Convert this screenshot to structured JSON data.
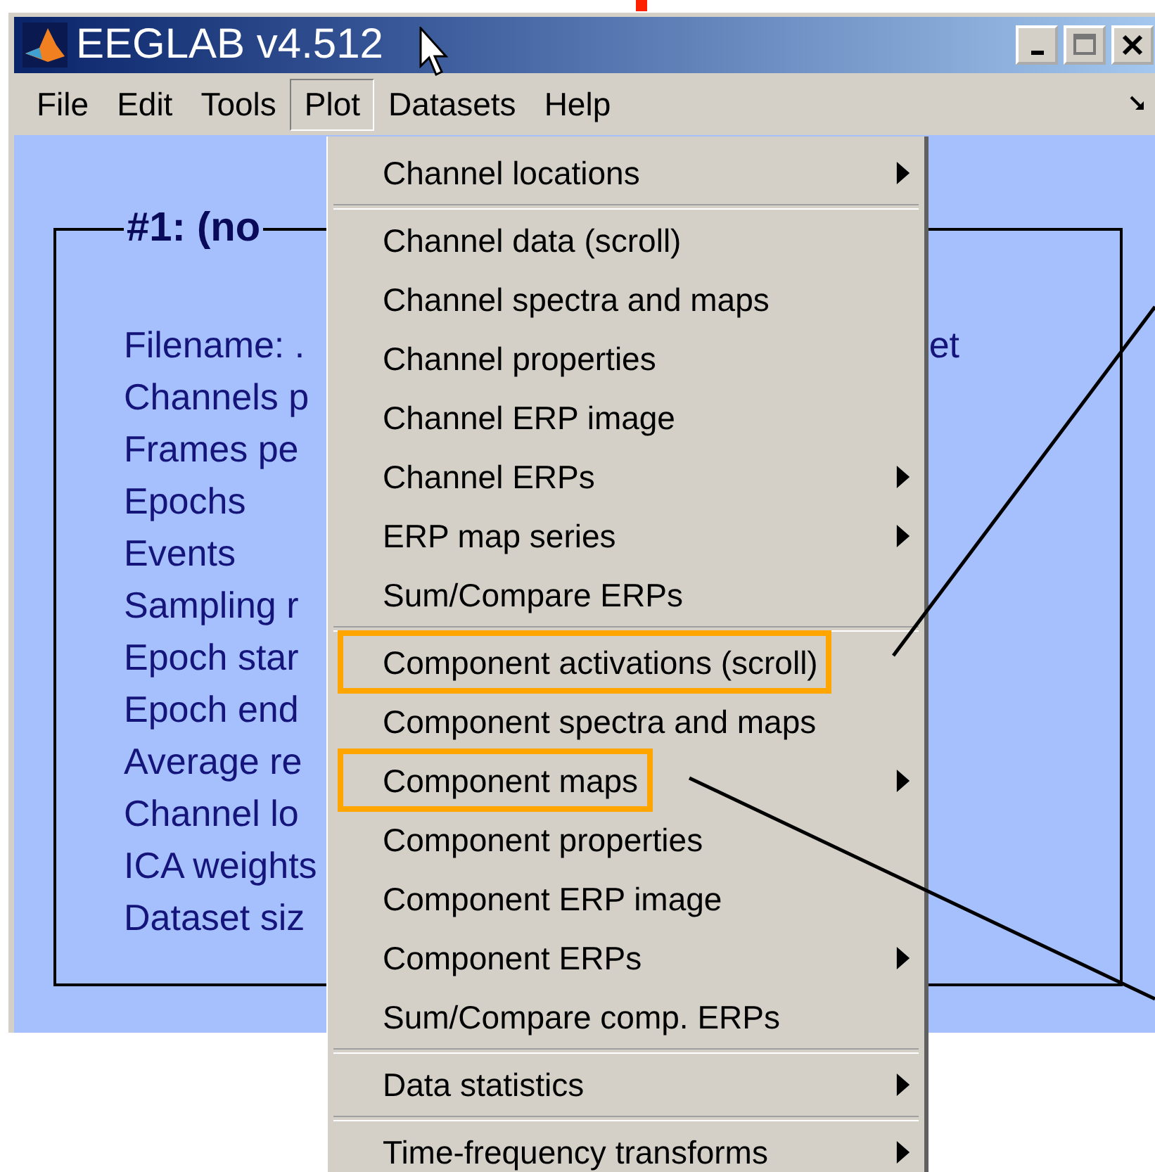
{
  "window": {
    "title": "EEGLAB v4.512"
  },
  "menubar": [
    {
      "label": "File",
      "selected": false
    },
    {
      "label": "Edit",
      "selected": false
    },
    {
      "label": "Tools",
      "selected": false
    },
    {
      "label": "Plot",
      "selected": true
    },
    {
      "label": "Datasets",
      "selected": false
    },
    {
      "label": "Help",
      "selected": false
    }
  ],
  "dataset_panel": {
    "title": "#1: (no",
    "lines": [
      {
        "label": "Filename: .",
        "value": "et"
      },
      {
        "label": "Channels p"
      },
      {
        "label": "Frames pe"
      },
      {
        "label": "Epochs"
      },
      {
        "label": "Events"
      },
      {
        "label": "Sampling r"
      },
      {
        "label": "Epoch star"
      },
      {
        "label": "Epoch end"
      },
      {
        "label": "Average re"
      },
      {
        "label": "Channel lo"
      },
      {
        "label": "ICA weights"
      },
      {
        "label": "Dataset siz"
      }
    ]
  },
  "plot_menu": {
    "sections": [
      {
        "items": [
          {
            "label": "Channel locations",
            "submenu": true,
            "highlighted": false
          }
        ]
      },
      {
        "items": [
          {
            "label": "Channel data (scroll)",
            "submenu": false,
            "highlighted": false
          },
          {
            "label": "Channel spectra and maps",
            "submenu": false,
            "highlighted": false
          },
          {
            "label": "Channel properties",
            "submenu": false,
            "highlighted": false
          },
          {
            "label": "Channel ERP image",
            "submenu": false,
            "highlighted": false
          },
          {
            "label": "Channel ERPs",
            "submenu": true,
            "highlighted": false
          },
          {
            "label": "ERP map series",
            "submenu": true,
            "highlighted": false
          },
          {
            "label": "Sum/Compare ERPs",
            "submenu": false,
            "highlighted": false
          }
        ]
      },
      {
        "items": [
          {
            "label": "Component activations (scroll)",
            "submenu": false,
            "highlighted": true
          },
          {
            "label": "Component spectra and maps",
            "submenu": false,
            "highlighted": false
          },
          {
            "label": "Component maps",
            "submenu": true,
            "highlighted": true
          },
          {
            "label": "Component properties",
            "submenu": false,
            "highlighted": false
          },
          {
            "label": "Component ERP image",
            "submenu": false,
            "highlighted": false
          },
          {
            "label": "Component ERPs",
            "submenu": true,
            "highlighted": false
          },
          {
            "label": "Sum/Compare comp. ERPs",
            "submenu": false,
            "highlighted": false
          }
        ]
      },
      {
        "items": [
          {
            "label": "Data statistics",
            "submenu": true,
            "highlighted": false
          }
        ]
      },
      {
        "items": [
          {
            "label": "Time-frequency transforms",
            "submenu": true,
            "highlighted": false
          }
        ]
      }
    ]
  }
}
